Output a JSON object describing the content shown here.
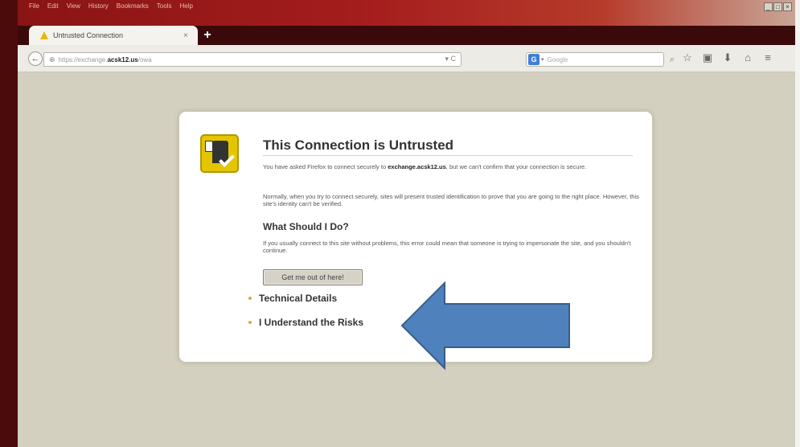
{
  "menu": [
    "File",
    "Edit",
    "View",
    "History",
    "Bookmarks",
    "Tools",
    "Help"
  ],
  "window_controls": [
    "_",
    "□",
    "×"
  ],
  "tab": {
    "title": "Untrusted Connection",
    "close": "×",
    "new_tab": "+"
  },
  "nav": {
    "back": "←",
    "url_prefix": "https://exchange.",
    "url_host": "acsk12.us",
    "url_suffix": "/owa",
    "reload": "▾ C",
    "search_engine": "G",
    "search_placeholder": "Google",
    "search_icon": "⌕",
    "toolbar_icons": [
      "☆",
      "▣",
      "⬇",
      "⌂",
      "≡"
    ]
  },
  "error": {
    "title": "This Connection is Untrusted",
    "p1_pre": "You have asked Firefox to connect securely to ",
    "p1_host": "exchange.acsk12.us",
    "p1_post": ", but we can't confirm that your connection is secure.",
    "p2": "Normally, when you try to connect securely, sites will present trusted identification to prove that you are going to the right place. However, this site's identity can't be verified.",
    "h2": "What Should I Do?",
    "p3": "If you usually connect to this site without problems, this error could mean that someone is trying to impersonate the site, and you shouldn't continue.",
    "button": "Get me out of here!",
    "technical": "Technical Details",
    "understand": "I Understand the Risks"
  },
  "colors": {
    "arrow": "#4f81bd",
    "arrow_border": "#385d8a",
    "content_bg": "#d3d0c0",
    "titlebar": "#a51d1d"
  }
}
